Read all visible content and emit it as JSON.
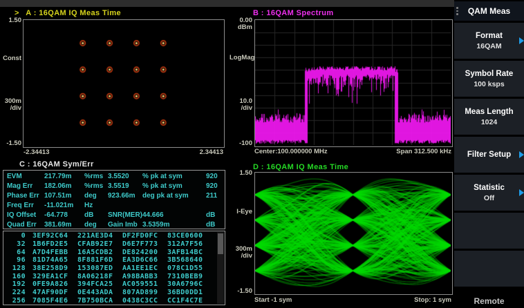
{
  "colors": {
    "yellow": "#d6d31c",
    "magenta": "#ee2fee",
    "green": "#25d825",
    "cyan": "#3ecaca",
    "arrow_blue": "#1e9ce8",
    "const_ring": "#bf3a10",
    "const_dot": "#ffd878",
    "spectrum_trace": "#f318f3",
    "eye_trace": "#00dc00"
  },
  "quadA": {
    "marker": ">",
    "header": "A : 16QAM IQ Meas Time",
    "y_top": "1.50",
    "y_mid": "Const",
    "y_div1": "300m",
    "y_div2": "/div",
    "y_bottom": "-1.50",
    "x_left": "-2.34413",
    "x_right": "2.34413"
  },
  "quadB": {
    "header": "B : 16QAM Spectrum",
    "y_top1": "0.00",
    "y_top2": "dBm",
    "y_mid": "LogMag",
    "y_div1": "10.0",
    "y_div2": "/div",
    "y_bottom": "-100",
    "x_left": "Center:100.000000 MHz",
    "x_right": "Span 312.500 kHz"
  },
  "quadC": {
    "header": "C : 16QAM Sym/Err",
    "rows": [
      [
        "EVM",
        "217.79m",
        "%rms",
        "3.5520",
        "% pk at sym",
        "920"
      ],
      [
        "Mag Err",
        "182.06m",
        "%rms",
        "3.5519",
        "% pk at sym",
        "920"
      ],
      [
        "Phase Err",
        "107.51m",
        "deg",
        "923.66m",
        "deg pk at sym",
        "211"
      ],
      [
        "Freq Err",
        "-11.021m",
        "Hz",
        "",
        "",
        ""
      ],
      [
        "IQ Offset",
        "-64.778",
        "dB",
        "SNR(MER)",
        "44.666",
        "dB"
      ],
      [
        "Quad Err",
        "381.69m",
        "deg",
        "Gain Imb",
        "3.5359m",
        "dB"
      ]
    ],
    "hex_rows": [
      [
        "0",
        "3EF92C64",
        "221AE3D4",
        "DF2FD0FC",
        "83CE0600"
      ],
      [
        "32",
        "1B6FD2E5",
        "CFAB92E7",
        "D6E7F773",
        "312A7F56"
      ],
      [
        "64",
        "A7D4FEBB",
        "16A5CDB2",
        "DE824200",
        "3AFB14BC"
      ],
      [
        "96",
        "81D74A65",
        "8F881F6D",
        "EA3D6C66",
        "3B568640"
      ],
      [
        "128",
        "38E258D9",
        "153087ED",
        "AA1EE1EC",
        "078C1D55"
      ],
      [
        "160",
        "329EA1CF",
        "8A06218F",
        "A98BABB3",
        "7310BEB9"
      ],
      [
        "192",
        "0FE9A826",
        "394FCA25",
        "AC059551",
        "30A6796C"
      ],
      [
        "224",
        "47AF90DF",
        "0E443ADA",
        "807AD899",
        "36BD0DD1"
      ],
      [
        "256",
        "7085F4E6",
        "7B750BCA",
        "0438C3CC",
        "CC1F4C7E"
      ]
    ]
  },
  "quadD": {
    "header": "D : 16QAM IQ Meas Time",
    "y_top": "1.50",
    "y_mid": "I-Eye",
    "y_div1": "300m",
    "y_div2": "/div",
    "y_bottom": "-1.50",
    "x_left": "Start -1 sym",
    "x_right": "Stop: 1 sym"
  },
  "sidebar": {
    "title": "QAM Meas",
    "items": [
      {
        "label": "Format",
        "value": "16QAM",
        "arrow": true
      },
      {
        "label": "Symbol Rate",
        "value": "100 ksps",
        "arrow": false
      },
      {
        "label": "Meas Length",
        "value": "1024",
        "arrow": false
      },
      {
        "label": "Filter Setup",
        "value": "",
        "arrow": true
      },
      {
        "label": "Statistic",
        "value": "Off",
        "arrow": true
      },
      {
        "label": "",
        "value": "",
        "arrow": false
      },
      {
        "label": "",
        "value": "",
        "arrow": false
      }
    ],
    "remote": "Remote"
  },
  "chart_data": [
    {
      "type": "scatter",
      "name": "constellation",
      "title": "16QAM IQ Meas Time",
      "xlim": [
        -2.34413,
        2.34413
      ],
      "ylim": [
        -1.5,
        1.5
      ],
      "scale_per_div": "300m",
      "points": [
        [
          -0.9487,
          0.9487
        ],
        [
          -0.3162,
          0.9487
        ],
        [
          0.3162,
          0.9487
        ],
        [
          0.9487,
          0.9487
        ],
        [
          -0.9487,
          0.3162
        ],
        [
          -0.3162,
          0.3162
        ],
        [
          0.3162,
          0.3162
        ],
        [
          0.9487,
          0.3162
        ],
        [
          -0.9487,
          -0.3162
        ],
        [
          -0.3162,
          -0.3162
        ],
        [
          0.3162,
          -0.3162
        ],
        [
          0.9487,
          -0.3162
        ],
        [
          -0.9487,
          -0.9487
        ],
        [
          -0.3162,
          -0.9487
        ],
        [
          0.3162,
          -0.9487
        ],
        [
          0.9487,
          -0.9487
        ]
      ]
    },
    {
      "type": "line",
      "name": "spectrum",
      "title": "16QAM Spectrum",
      "center": "100.000000 MHz",
      "span": "312.500 kHz",
      "ref_level_dbm": 0.0,
      "scale_db_per_div": 10.0,
      "bottom_dbm": -100,
      "grid_divs": 10,
      "band_left_frac": 0.26,
      "band_right_frac": 0.72,
      "signal_top_frac": 0.37,
      "signal_fuzz_frac": 0.18,
      "noise_floor_frac": 0.82
    },
    {
      "type": "line",
      "name": "eye-diagram",
      "title": "16QAM IQ Meas Time",
      "start_sym": -1,
      "stop_sym": 1,
      "ylim": [
        -1.5,
        1.5
      ],
      "scale_per_div": "300m",
      "levels": [
        -0.9487,
        -0.3162,
        0.3162,
        0.9487
      ]
    }
  ]
}
